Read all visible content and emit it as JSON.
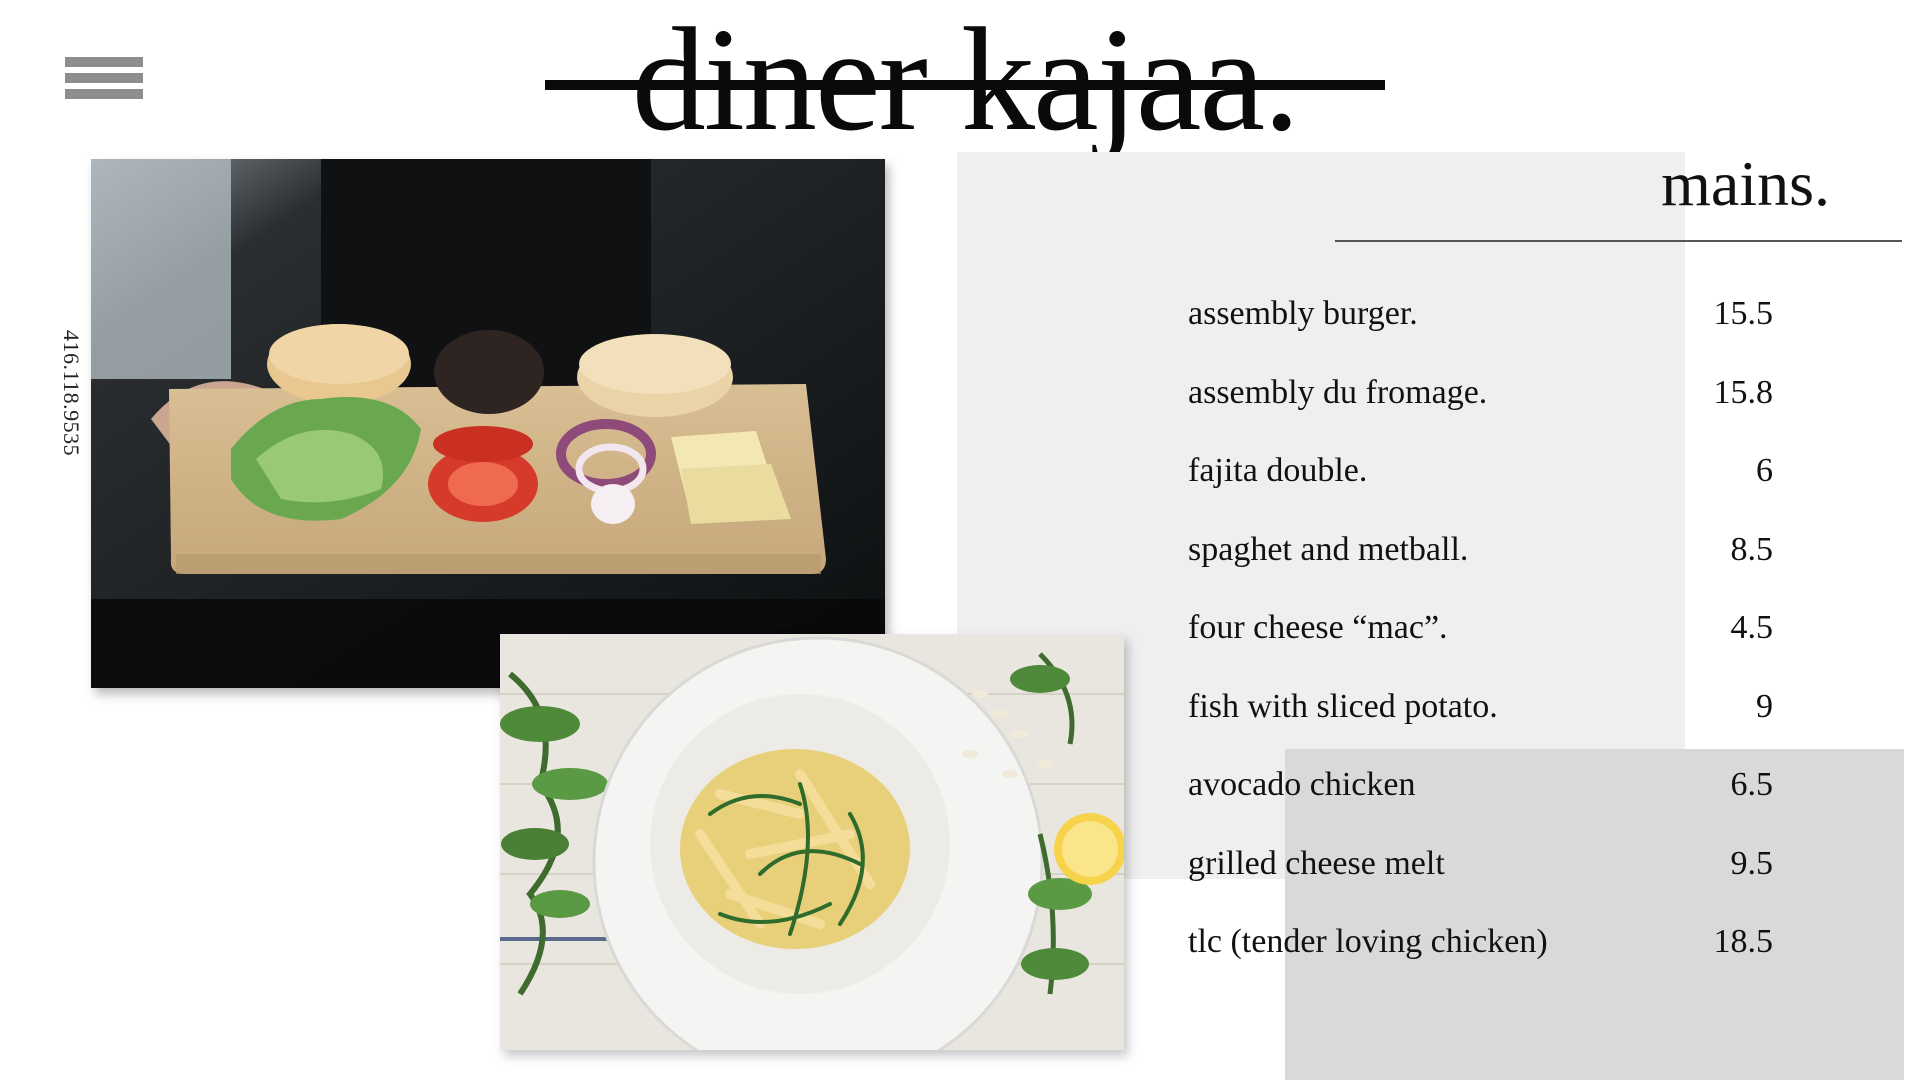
{
  "header": {
    "brand": "diner kajaa.",
    "menu_icon": "hamburger-menu-icon"
  },
  "contact": {
    "phone": "416.118.9535"
  },
  "images": {
    "burger": "burger-ingredients-board-photo",
    "pasta": "pasta-plate-photo"
  },
  "menu": {
    "title": "mains.",
    "items": [
      {
        "name": "assembly burger.",
        "price": "15.5"
      },
      {
        "name": "assembly du fromage.",
        "price": "15.8"
      },
      {
        "name": "fajita double.",
        "price": "6"
      },
      {
        "name": "spaghet and metball.",
        "price": "8.5"
      },
      {
        "name": "four cheese “mac”.",
        "price": "4.5"
      },
      {
        "name": "fish with sliced potato.",
        "price": "9"
      },
      {
        "name": "avocado chicken",
        "price": "6.5"
      },
      {
        "name": "grilled cheese melt",
        "price": "9.5"
      },
      {
        "name": "tlc (tender loving chicken)",
        "price": "18.5"
      }
    ]
  },
  "colors": {
    "panel_light": "#efefef",
    "panel_grey": "#d9d9d9",
    "hamburger": "#8e8e8e",
    "text": "#111111"
  }
}
